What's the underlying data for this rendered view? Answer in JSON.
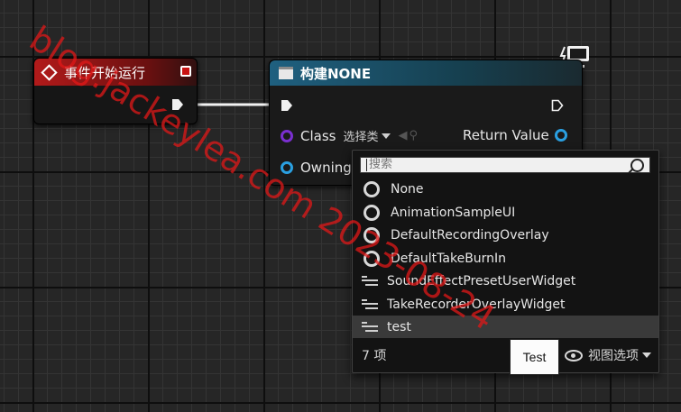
{
  "event_node": {
    "title": "事件开始运行"
  },
  "build_node": {
    "title": "构建NONE",
    "class_label": "Class",
    "class_combo": "选择类",
    "return_label": "Return Value",
    "owning_label": "Owning"
  },
  "class_picker": {
    "search_placeholder": "搜索",
    "items": [
      {
        "label": "None",
        "icon": "class-ring-icon"
      },
      {
        "label": "AnimationSampleUI",
        "icon": "class-ring-icon"
      },
      {
        "label": "DefaultRecordingOverlay",
        "icon": "class-ring-icon"
      },
      {
        "label": "DefaultTakeBurnIn",
        "icon": "class-ring-icon"
      },
      {
        "label": "SoundEffectPresetUserWidget",
        "icon": "widget-blueprint-icon"
      },
      {
        "label": "TakeRecorderOverlayWidget",
        "icon": "widget-blueprint-icon"
      },
      {
        "label": "test",
        "icon": "widget-blueprint-icon"
      }
    ],
    "count": "7 项",
    "view_options": "视图选项"
  },
  "tooltip": {
    "text": "Test"
  },
  "watermark": {
    "text": "blog.jackeylea.com 2023-08-24"
  },
  "colors": {
    "event_header": "#b21a1a",
    "build_header": "#1f6080",
    "class_pin": "#7a2fd0",
    "object_pin": "#2a9fe0",
    "watermark": "#e01818"
  }
}
